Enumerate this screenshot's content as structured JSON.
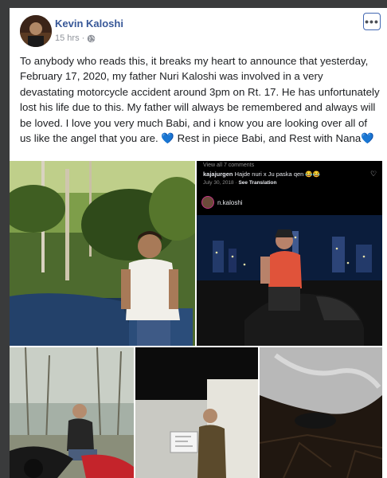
{
  "post": {
    "author": "Kevin Kaloshi",
    "time": "15 hrs",
    "more_label": "•••",
    "text_main": "To anybody who reads this, it breaks my heart to announce that yesterday, February 17, 2020, my father Nuri Kaloshi was involved in a very devastating motorcycle accident around 3pm on Rt. 17. He has unfortunately lost his life due to this. My father will always be remembered and always will be loved. I love you very much Babi, and i know you are looking over all of us like the angel that you are.",
    "heart1": "💙",
    "text_tail1": " Rest in piece Babi, and Rest with Nana",
    "heart2": "💙"
  },
  "instagram": {
    "view_comments": "View all 7 comments",
    "comment_user": "kajajurgen",
    "comment_text": "Hajde  nuri  x Ju paska qen 😂😂",
    "comment_date": "July 30, 2018",
    "see_translation": "See Translation",
    "profile_name": "n.kaloshi",
    "heart_outline": "♡"
  },
  "colors": {
    "page_bg": "#3a3b3c",
    "author": "#385898",
    "heart": "#3a8ee6"
  }
}
